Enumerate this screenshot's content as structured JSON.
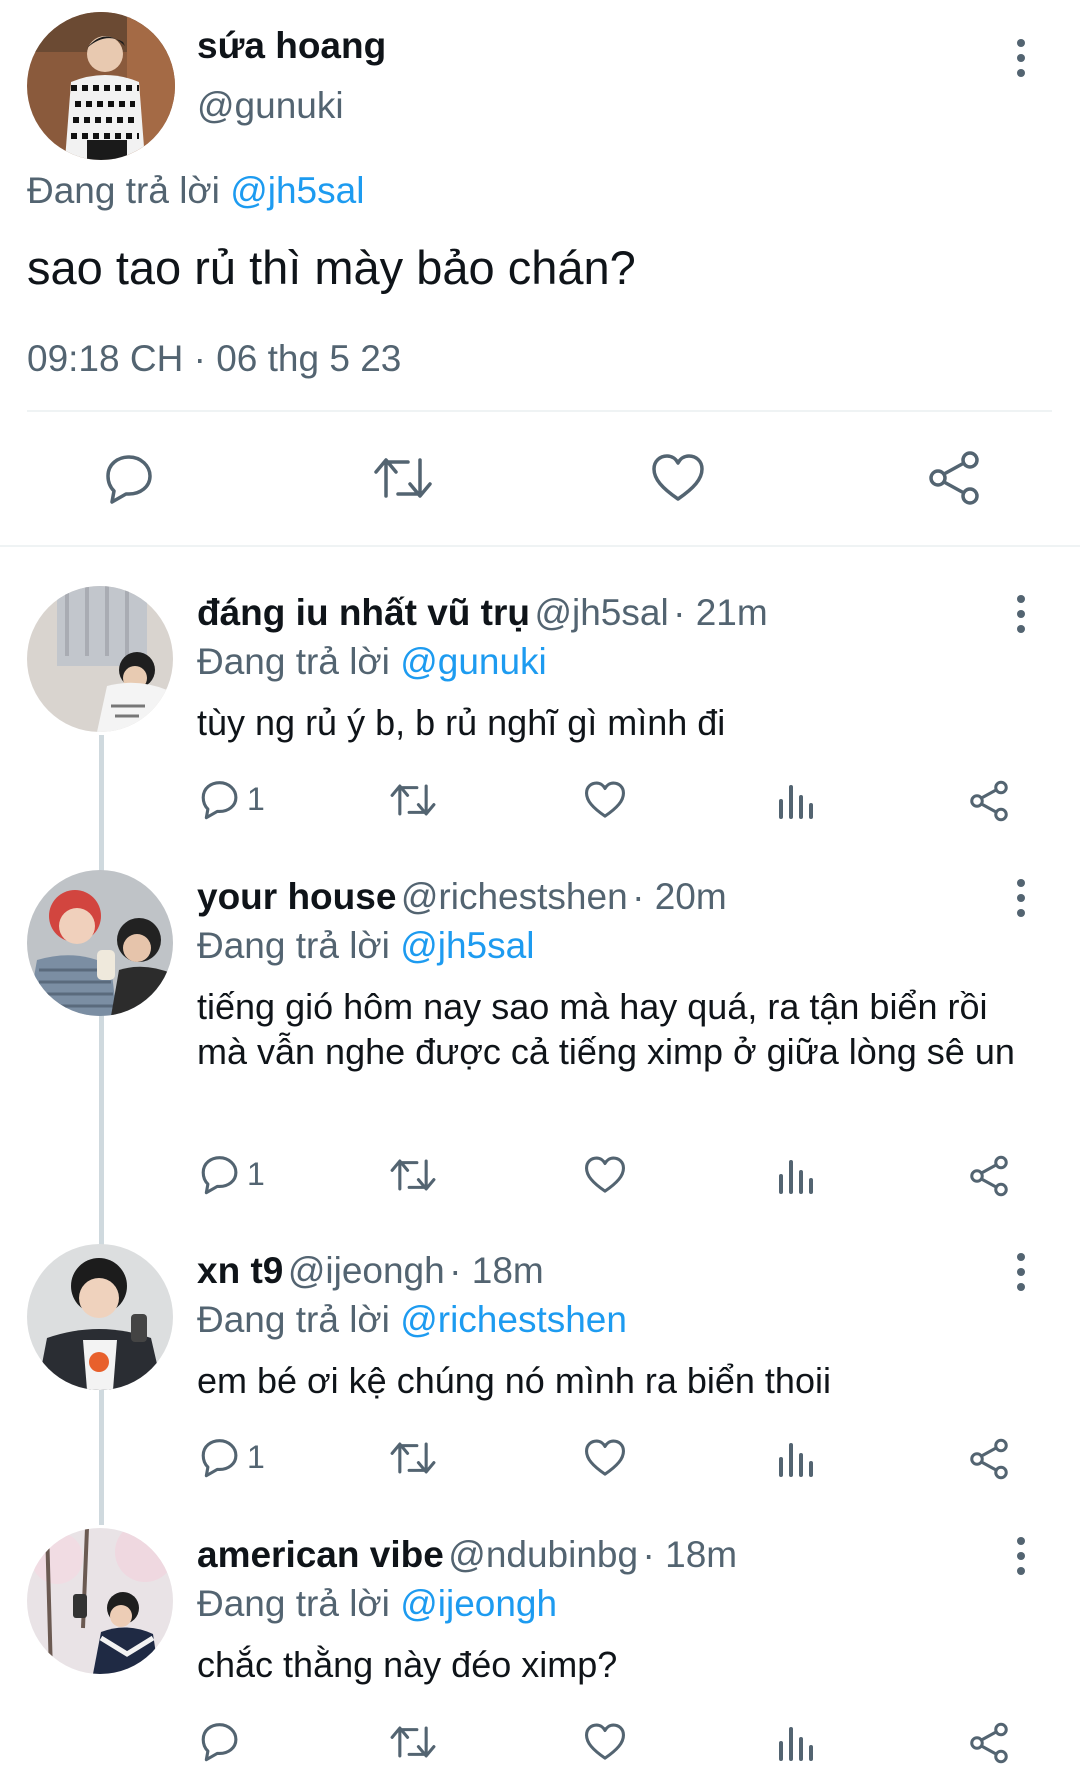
{
  "main_tweet": {
    "name": "sứa hoang",
    "handle": "@gunuki",
    "replying_prefix": "Đang trả lời ",
    "replying_to": "@jh5sal",
    "text": "sao tao rủ thì mày bảo chán?",
    "timestamp": "09:18 CH · 06 thg 5 23",
    "actions": [
      "reply-icon",
      "retweet-icon",
      "like-icon",
      "share-icon"
    ]
  },
  "replies": [
    {
      "name": "đáng iu nhất vũ trụ",
      "handle": "@jh5sal",
      "time": "· 21m",
      "replying_prefix": "Đang trả lời ",
      "replying_to": "@gunuki",
      "text": "tùy ng rủ ý b, b rủ nghĩ gì mình đi",
      "reply_count": "1"
    },
    {
      "name": "your house",
      "handle": "@richestshen",
      "time": "· 20m",
      "replying_prefix": "Đang trả lời ",
      "replying_to": "@jh5sal",
      "text": "tiếng gió hôm nay sao mà hay quá, ra tận biển rồi mà vẫn nghe được cả tiếng ximp ở giữa lòng sê un",
      "reply_count": "1"
    },
    {
      "name": "xn t9",
      "handle": "@ijeongh",
      "time": "· 18m",
      "replying_prefix": "Đang trả lời ",
      "replying_to": "@richestshen",
      "text": "em bé ơi kệ chúng nó mình ra biển thoii",
      "reply_count": "1"
    },
    {
      "name": "american vibe",
      "handle": "@ndubinbg",
      "time": "· 18m",
      "replying_prefix": "Đang trả lời ",
      "replying_to": "@ijeongh",
      "text": "chắc thằng này đéo ximp?",
      "reply_count": ""
    }
  ],
  "colors": {
    "link": "#1d9bf0",
    "muted": "#536471",
    "text": "#0f1419",
    "divider": "#eff3f4"
  }
}
